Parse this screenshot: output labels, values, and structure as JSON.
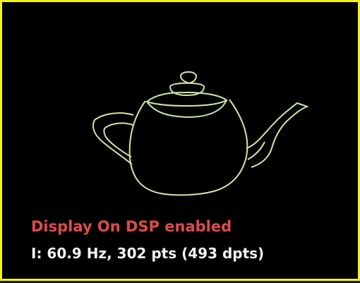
{
  "display": {
    "status_line_1": "Display On DSP enabled",
    "status_line_2": "I: 60.9 Hz, 302 pts (493 dpts)"
  },
  "colors": {
    "frame": "#f2f21f",
    "background": "#000000",
    "wireframe": "#cfe8a8",
    "status_red": "#e34a4a",
    "status_white": "#f3f3f3"
  }
}
